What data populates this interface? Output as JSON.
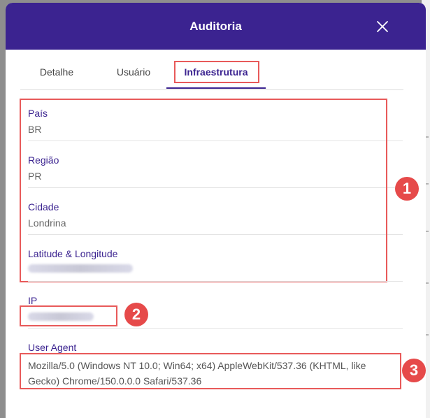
{
  "modal": {
    "title": "Auditoria"
  },
  "tabs": [
    {
      "label": "Detalhe",
      "active": false
    },
    {
      "label": "Usuário",
      "active": false
    },
    {
      "label": "Infraestrutura",
      "active": true
    }
  ],
  "fields": {
    "pais": {
      "label": "País",
      "value": "BR"
    },
    "regiao": {
      "label": "Região",
      "value": "PR"
    },
    "cidade": {
      "label": "Cidade",
      "value": "Londrina"
    },
    "latlong": {
      "label": "Latitude & Longitude",
      "value": ""
    },
    "ip": {
      "label": "IP",
      "value": ""
    },
    "user_agent": {
      "label": "User Agent",
      "value": "Mozilla/5.0 (Windows NT 10.0; Win64; x64) AppleWebKit/537.36 (KHTML, like Gecko) Chrome/150.0.0.0 Safari/537.36"
    }
  },
  "annotations": [
    "1",
    "2",
    "3"
  ],
  "colors": {
    "header": "#3b2390",
    "accent": "#3b2390",
    "highlight": "#e85a5a",
    "badge": "#e64a4a"
  }
}
